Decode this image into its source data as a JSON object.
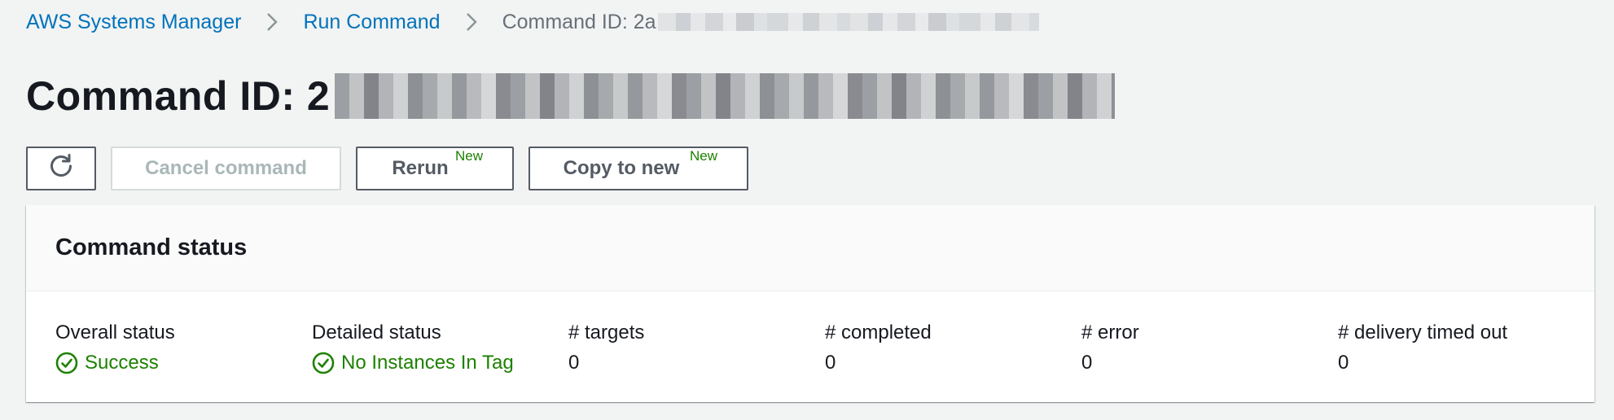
{
  "breadcrumb": {
    "root": "AWS Systems Manager",
    "section": "Run Command",
    "current_prefix": "Command ID: 2a"
  },
  "page": {
    "title_prefix": "Command ID: 2"
  },
  "toolbar": {
    "refresh_icon": "refresh-icon",
    "cancel_label": "Cancel command",
    "rerun_label": "Rerun",
    "rerun_badge": "New",
    "copy_label": "Copy to new",
    "copy_badge": "New"
  },
  "command_status": {
    "title": "Command status",
    "overall_status": {
      "label": "Overall status",
      "value": "Success",
      "icon": "check-circle-icon"
    },
    "detailed_status": {
      "label": "Detailed status",
      "value": "No Instances In Tag",
      "icon": "check-circle-icon"
    },
    "targets": {
      "label": "# targets",
      "value": "0"
    },
    "completed": {
      "label": "# completed",
      "value": "0"
    },
    "error": {
      "label": "# error",
      "value": "0"
    },
    "delivery_timed_out": {
      "label": "# delivery timed out",
      "value": "0"
    }
  },
  "colors": {
    "link": "#0073bb",
    "success": "#1d8102",
    "background": "#f2f3f3",
    "text": "#16191f"
  }
}
